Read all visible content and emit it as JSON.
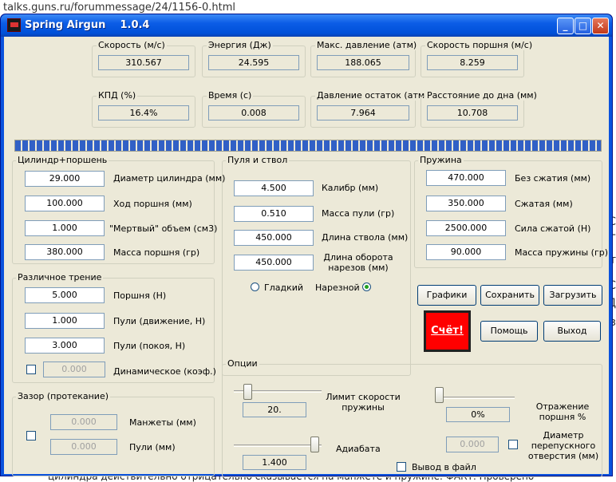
{
  "background": {
    "url": "talks.guns.ru/forummessage/24/1156-0.html",
    "bottom_text": "цилиндра действительно отрицательно сказывается на манжете и пружине. ФАКТ. Проверено",
    "right_chars": [
      "С",
      "Г",
      "т",
      "С",
      "Д",
      "з"
    ]
  },
  "window": {
    "title": "Spring Airgun    1.0.4",
    "min": "_",
    "max": "□",
    "close": "✕"
  },
  "results": {
    "row1": [
      {
        "label": "Скорость (м/с)",
        "value": "310.567"
      },
      {
        "label": "Энергия (Дж)",
        "value": "24.595"
      },
      {
        "label": "Макс. давление (атм)",
        "value": "188.065"
      },
      {
        "label": "Скорость поршня (м/с)",
        "value": "8.259"
      }
    ],
    "row2": [
      {
        "label": "КПД (%)",
        "value": "16.4%"
      },
      {
        "label": "Время (с)",
        "value": "0.008"
      },
      {
        "label": "Давление остаток (атм)",
        "value": "7.964"
      },
      {
        "label": "Расстояние до дна (мм)",
        "value": "10.708"
      }
    ]
  },
  "progress": 1.0,
  "cylinder": {
    "title": "Цилиндр+поршень",
    "rows": [
      {
        "value": "29.000",
        "label": "Диаметр цилиндра (мм)"
      },
      {
        "value": "100.000",
        "label": "Ход поршня (мм)"
      },
      {
        "value": "1.000",
        "label": "\"Мертвый\" объем (см3)"
      },
      {
        "value": "380.000",
        "label": "Масса поршня (гр)"
      }
    ]
  },
  "friction": {
    "title": "Различное трение",
    "rows": [
      {
        "value": "5.000",
        "label": "Поршня (Н)"
      },
      {
        "value": "1.000",
        "label": "Пули (движение, Н)"
      },
      {
        "value": "3.000",
        "label": "Пули (покоя, Н)"
      }
    ],
    "dynamic": {
      "value": "0.000",
      "label": "Динамическое (коэф.)",
      "checked": false
    }
  },
  "gap": {
    "title": "Зазор (протекание)",
    "rows": [
      {
        "value": "0.000",
        "label": "Манжеты (мм)"
      },
      {
        "value": "0.000",
        "label": "Пули (мм)"
      }
    ],
    "checked": false
  },
  "bullet": {
    "title": "Пуля и ствол",
    "rows": [
      {
        "value": "4.500",
        "label": "Калибр (мм)"
      },
      {
        "value": "0.510",
        "label": "Масса пули (гр)"
      },
      {
        "value": "450.000",
        "label": "Длина ствола (мм)"
      },
      {
        "value": "450.000",
        "label": "Длина оборота нарезов (мм)"
      }
    ],
    "smooth": "Гладкий",
    "rifled": "Нарезной",
    "selected": "rifled"
  },
  "spring": {
    "title": "Пружина",
    "rows": [
      {
        "value": "470.000",
        "label": "Без  сжатия (мм)"
      },
      {
        "value": "350.000",
        "label": "Сжатая (мм)"
      },
      {
        "value": "2500.000",
        "label": "Сила сжатой (Н)"
      },
      {
        "value": "90.000",
        "label": "Масса пружины (гр)"
      }
    ]
  },
  "buttons": {
    "graphs": "Графики",
    "save": "Сохранить",
    "load": "Загрузить",
    "calc": "Счёт!",
    "help": "Помощь",
    "exit": "Выход"
  },
  "options": {
    "title": "Опции",
    "speed_limit": {
      "value": "20.",
      "label": "Лимит скорости пружины",
      "level": 0.12
    },
    "adiabata": {
      "value": "1.400",
      "label": "Адиабата",
      "level": 0.97
    },
    "reflection": {
      "value": "0%",
      "label": "Отражение поршня %",
      "level": 0.0
    },
    "bypass": {
      "value": "0.000",
      "label": "Диаметр перепускного отверстия (мм)",
      "checked": false
    },
    "output": {
      "label": "Вывод в файл",
      "checked": false
    }
  }
}
